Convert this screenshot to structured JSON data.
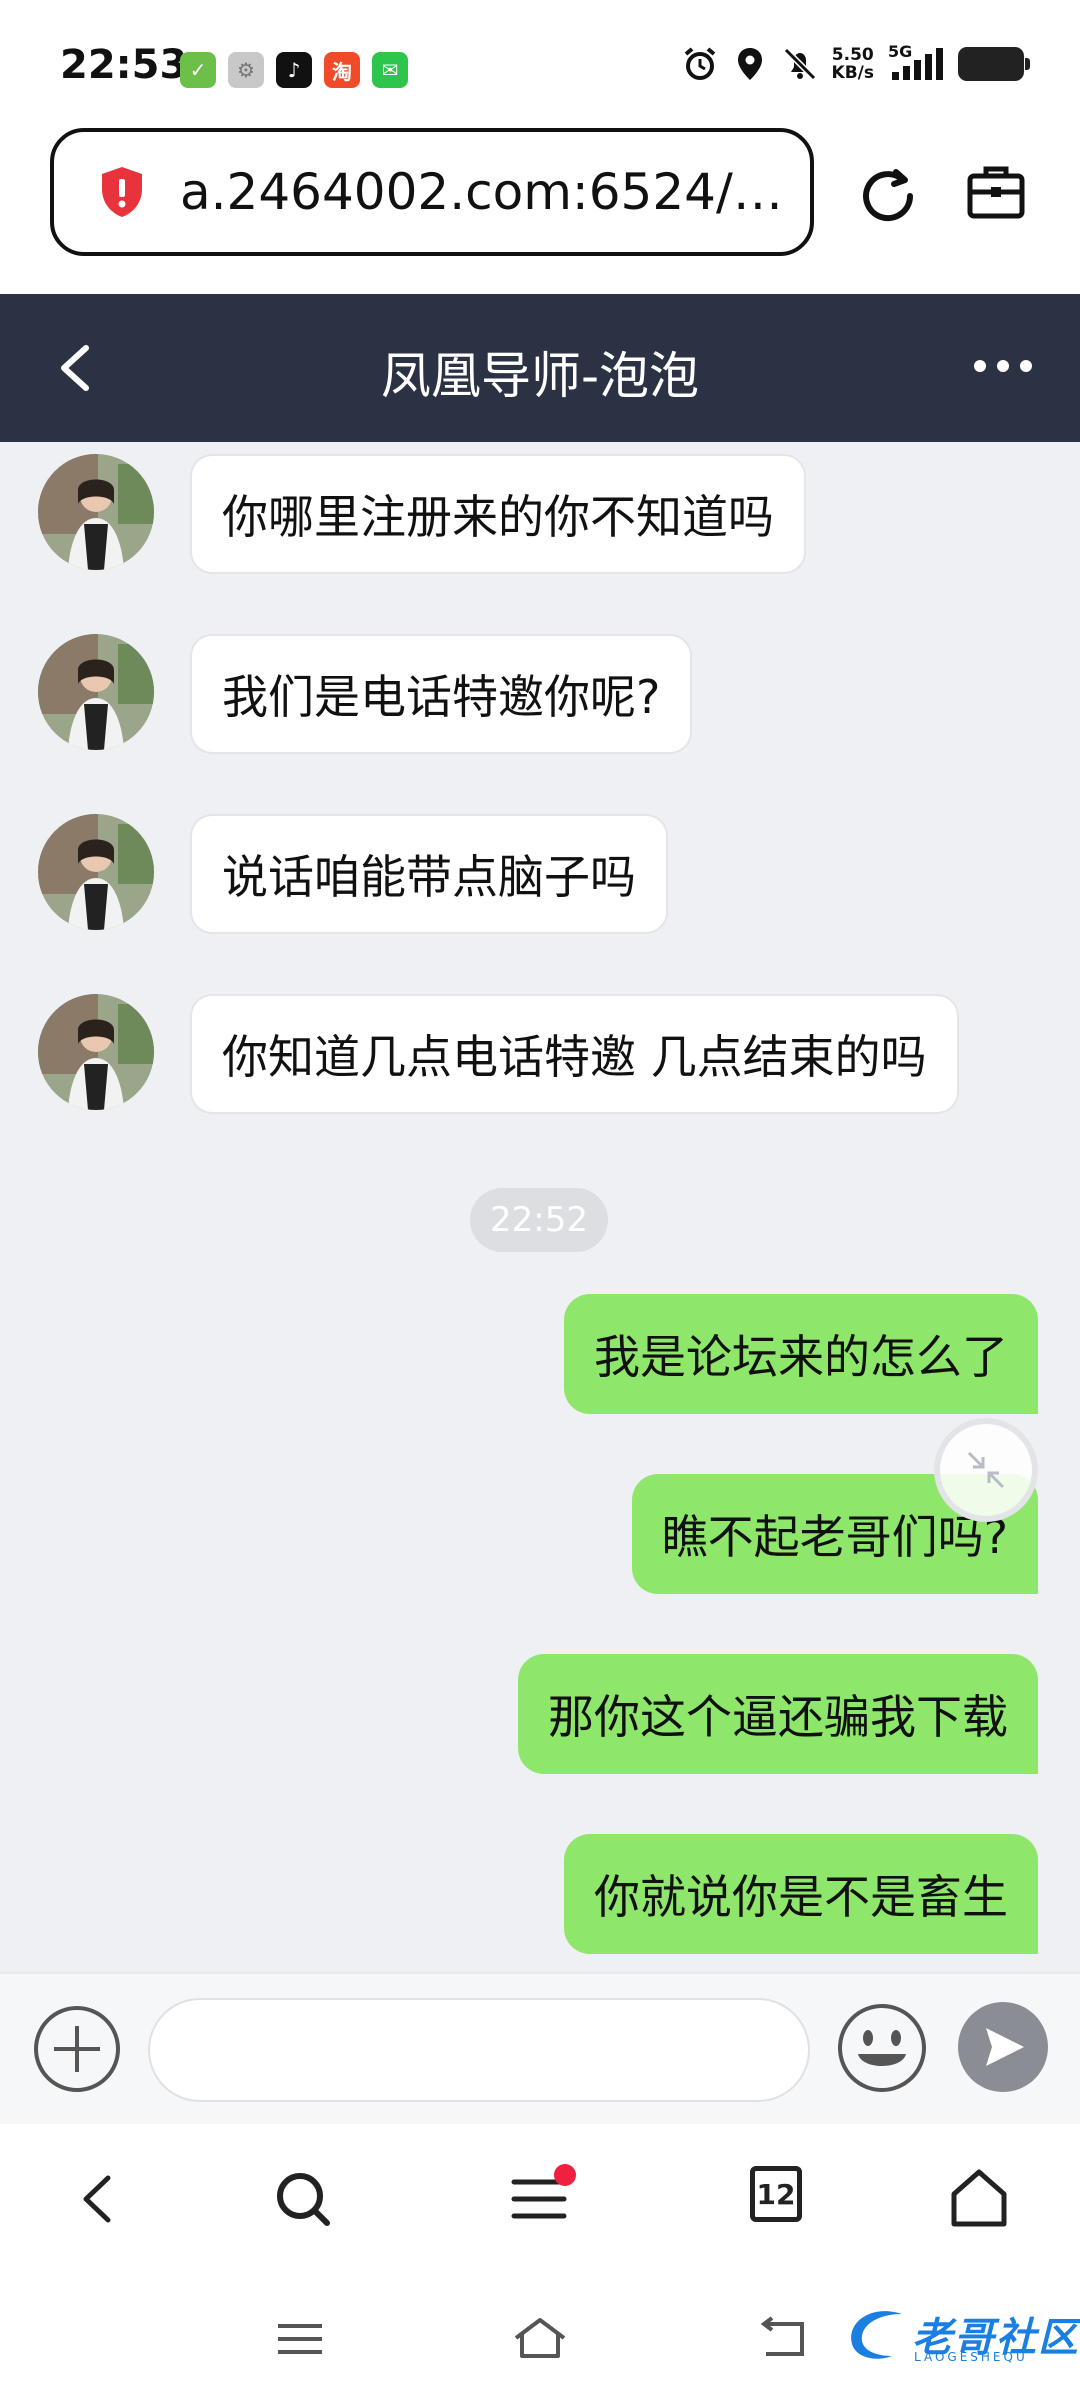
{
  "status_bar": {
    "time": "22:53",
    "net_speed_value": "5.50",
    "net_speed_unit": "KB/s",
    "network": "5G"
  },
  "browser": {
    "url": "a.2464002.com:6524/…"
  },
  "chat": {
    "title": "凤凰导师-泡泡",
    "incoming": [
      "你哪里注册来的你不知道吗",
      "我们是电话特邀你呢?",
      "说话咱能带点脑子吗",
      "你知道几点电话特邀 几点结束的吗"
    ],
    "timestamp": "22:52",
    "outgoing": [
      "我是论坛来的怎么了",
      "瞧不起老哥们吗?",
      "那你这个逼还骗我下载",
      "你就说你是不是畜生"
    ]
  },
  "input": {
    "placeholder": ""
  },
  "browser_nav": {
    "tabs_count": "12"
  },
  "watermark": {
    "text": "老哥社区",
    "sub": "LAOGESHEQU"
  },
  "colors": {
    "header_bg": "#2a3244",
    "chat_bg": "#eef0f4",
    "outgoing_bubble": "#8ee66a",
    "incoming_bubble": "#ffffff",
    "shield_red": "#e8323c"
  }
}
